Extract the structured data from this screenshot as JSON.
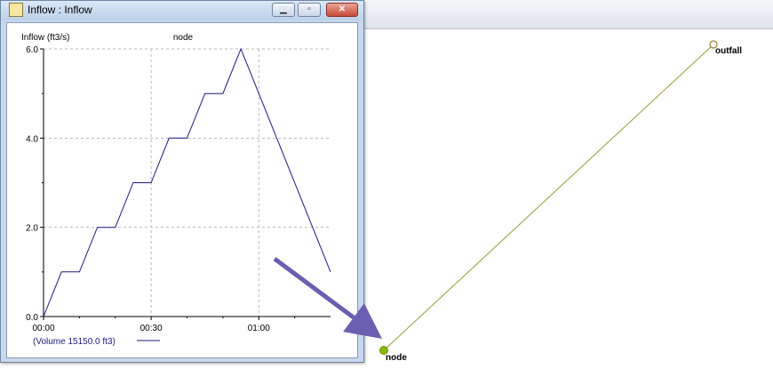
{
  "window": {
    "title": "Inflow : Inflow",
    "minimize_icon": "minimize-icon",
    "maximize_icon": "maximize-icon",
    "close_icon": "close-icon"
  },
  "chart_data": {
    "type": "line",
    "title": "node",
    "ylabel": "Inflow (ft3/s)",
    "xlabel": "",
    "x_ticks": [
      "00:00",
      "00:30",
      "01:00"
    ],
    "y_ticks": [
      "0.0",
      "2.0",
      "4.0",
      "6.0"
    ],
    "ylim": [
      0,
      6
    ],
    "xlim_minutes": [
      0,
      80
    ],
    "grid": true,
    "legend": "bottom-left",
    "series": [
      {
        "name": "(Volume 15150.0 ft3)",
        "color": "#1a1a80",
        "x_minutes": [
          0,
          5,
          10,
          15,
          20,
          25,
          30,
          35,
          40,
          45,
          50,
          55,
          80
        ],
        "y": [
          0,
          1,
          1,
          2,
          2,
          3,
          3,
          4,
          4,
          5,
          5,
          6,
          1
        ]
      }
    ]
  },
  "map": {
    "nodes": [
      {
        "name": "outfall"
      },
      {
        "name": "node"
      }
    ],
    "link_color": "#9a9a3a",
    "node_fill": "#8ab800"
  },
  "annotation": {
    "arrow_color": "#6a5fb0"
  }
}
